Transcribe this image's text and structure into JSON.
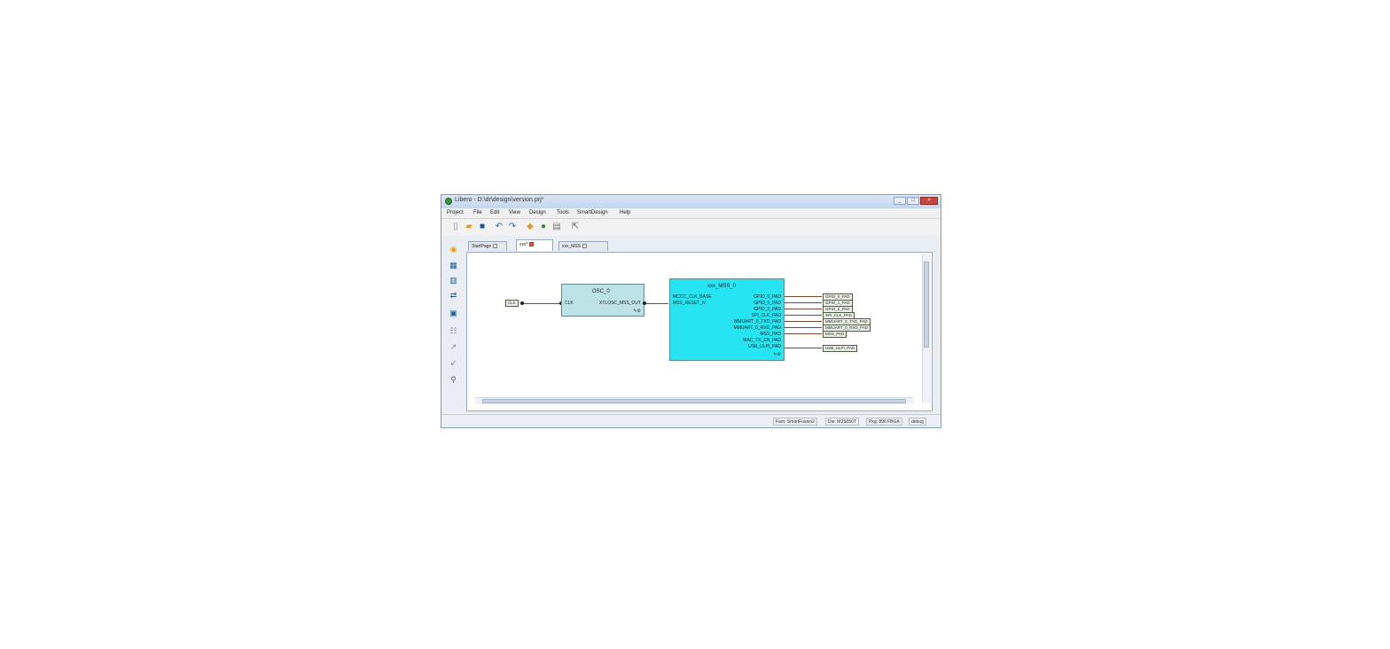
{
  "window": {
    "title": "Libero - D:\\dr\\design\\version.prj*",
    "buttons": [
      "_",
      "□",
      "×"
    ]
  },
  "menu": [
    "Project",
    "File",
    "Edit",
    "View",
    "Design",
    "Tools",
    "SmartDesign",
    "Help"
  ],
  "toolbar": {
    "icons": [
      "new-file-icon",
      "open-folder-icon",
      "save-icon",
      "undo-icon",
      "redo-icon",
      "build-icon",
      "run-icon",
      "report-icon",
      "export-icon"
    ]
  },
  "left_toolbar": {
    "icons": [
      "design-flow-icon",
      "grid-icon",
      "layout-icon",
      "connect-icon",
      "pins-icon",
      "sheet-icon",
      "expand-icon",
      "collapse-icon",
      "zoom-icon"
    ]
  },
  "tabs": [
    {
      "label": "StartPage",
      "active": false
    },
    {
      "label": "xxx*",
      "active": true
    },
    {
      "label": "xxx_MSS",
      "active": false
    }
  ],
  "diagram": {
    "input_net": "CLK",
    "block1": {
      "title": "OSC_0",
      "in_port": "CLK",
      "out_port": "XTLOSC_MSS_OUT"
    },
    "block2": {
      "title": "xxx_MSS_0",
      "in_ports": [
        "MCCC_CLK_BASE",
        "MSS_RESET_N"
      ],
      "out_ports": [
        "GPIO_0_PAD",
        "GPIO_1_PAD",
        "GPIO_2_PAD",
        "SPI_CLK_PAD",
        "MMUART_0_TXD_PAD",
        "MMUART_0_RXD_PAD",
        "MSS_PAD",
        "MAC_TX_EN_PAD",
        "USB_ULPI_PAD"
      ]
    },
    "output_nets": [
      "GPIO_0_PAD",
      "GPIO_1_PAD",
      "GPIO_2_PAD",
      "SPI_CLK_PAD",
      "MMUART_0_TXD_PAD",
      "MMUART_0_RXD_PAD",
      "MSS_PAD",
      "USB_ULPI_PAD"
    ]
  },
  "status": {
    "family": "Fam: SmartFusion2",
    "device": "Die: M2S050T",
    "package": "Pkg: 896 FBGA",
    "mode": "debug"
  },
  "colors": {
    "block1_fill": "#bde3e6",
    "block2_fill": "#27e4f2",
    "wire": "#7a4a30",
    "titlebar": "#c9d9ee"
  }
}
